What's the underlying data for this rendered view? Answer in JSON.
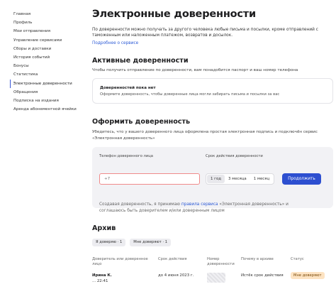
{
  "sidebar": {
    "items": [
      {
        "label": "Главная"
      },
      {
        "label": "Профиль"
      },
      {
        "label": "Мои отправления"
      },
      {
        "label": "Управление сервисами"
      },
      {
        "label": "Сборы и доставки"
      },
      {
        "label": "История событий"
      },
      {
        "label": "Бонусы"
      },
      {
        "label": "Статистика"
      },
      {
        "label": "Электронные доверенности"
      },
      {
        "label": "Обращения"
      },
      {
        "label": "Подписка на издания"
      },
      {
        "label": "Аренда абонементной ячейки"
      }
    ],
    "active_index": 8
  },
  "page": {
    "title": "Электронные доверенности",
    "intro": "По доверенности можно получать за другого человека любые письма и посылки, кроме отправлений с таможенным или наложенным платежом, возвратов и досылок.",
    "more_link": "Подробнее о сервисе"
  },
  "active": {
    "title": "Активные доверенности",
    "subtitle": "Чтобы получить отправление по доверенности, вам понадобится паспорт и ваш номер телефона",
    "empty_title": "Доверенностей пока нет",
    "empty_text": "Оформите доверенность, чтобы доверенные лица могли забирать письма и посылки за вас"
  },
  "form": {
    "title": "Оформить доверенность",
    "subtitle_line1": "Убедитесь, что у вашего доверенного лица оформлена простая электронная подпись и подключён сервис",
    "subtitle_line2": "«Электронная доверенность»",
    "phone_label": "Телефон доверенного лица",
    "phone_placeholder": "+7",
    "period_label": "Срок действия доверенности",
    "periods": [
      "1 год",
      "3 месяца",
      "1 месяц"
    ],
    "selected_period": 0,
    "submit_label": "Продолжить",
    "consent_before": "Создавая доверенность, я принимаю ",
    "consent_link": "правила сервиса",
    "consent_after": " «Электронная доверенность» и соглашаюсь быть доверителем и/или доверенным лицом"
  },
  "archive": {
    "title": "Архив",
    "filters": [
      "Я доверяю · 1",
      "Мне доверяют · 1"
    ],
    "columns": [
      {
        "line1": "Доверитель или доверенное",
        "line2": "лицо"
      },
      {
        "line1": "Срок действия",
        "line2": ""
      },
      {
        "line1": "Номер",
        "line2": "доверенности"
      },
      {
        "line1": "Почему в архиве",
        "line2": ""
      },
      {
        "line1": "Статус",
        "line2": ""
      }
    ],
    "rows": [
      {
        "name": "Ирина К.",
        "time": "... 22:41",
        "validity": "до 4 июня 2023 г.",
        "reason": "Истёк срок действия",
        "status": "Мне доверяют"
      }
    ]
  }
}
